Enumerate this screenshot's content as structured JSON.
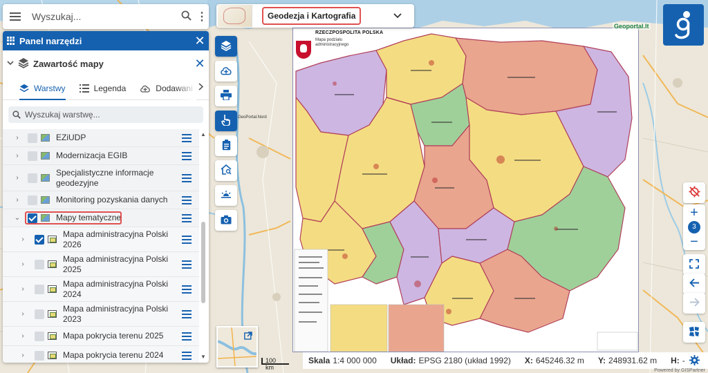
{
  "search": {
    "placeholder": "Wyszukaj...",
    "menu_icon": "hamburger-icon",
    "search_icon": "search-icon",
    "more_icon": "kebab-icon"
  },
  "theme": {
    "label": "Geodezja i Kartografia",
    "dropdown_icon": "chevron-down-icon"
  },
  "panel": {
    "title": "Panel narzędzi",
    "content_title": "Zawartość mapy",
    "tabs": [
      {
        "label": "Warstwy",
        "icon": "layers-icon",
        "active": true
      },
      {
        "label": "Legenda",
        "icon": "list-icon",
        "active": false
      },
      {
        "label": "Dodawani",
        "icon": "cloud-add-icon",
        "active": false
      }
    ],
    "layer_search_placeholder": "Wyszukaj warstwę...",
    "layers": [
      {
        "label": "EZiUDP",
        "checked": false,
        "level": 0
      },
      {
        "label": "Modernizacja EGIB",
        "checked": false,
        "level": 0
      },
      {
        "label": "Specjalistyczne informacje geodezyjne",
        "checked": false,
        "level": 0
      },
      {
        "label": "Monitoring pozyskania danych",
        "checked": false,
        "level": 0
      },
      {
        "label": "Mapy tematyczne",
        "checked": true,
        "level": 0,
        "expanded": true
      },
      {
        "label": "Mapa administracyjna Polski 2026",
        "checked": true,
        "level": 1
      },
      {
        "label": "Mapa administracyjna Polski 2025",
        "checked": false,
        "level": 1
      },
      {
        "label": "Mapa administracyjna Polski 2024",
        "checked": false,
        "level": 1
      },
      {
        "label": "Mapa administracyjna Polski 2023",
        "checked": false,
        "level": 1
      },
      {
        "label": "Mapa pokrycia terenu 2025",
        "checked": false,
        "level": 1
      },
      {
        "label": "Mapa pokrycia terenu 2024",
        "checked": false,
        "level": 1
      }
    ]
  },
  "map": {
    "poster_title": "RZECZPOSPOLITA POLSKA",
    "poster_subtitle": "Mapa podziału administracyjnego",
    "basemap_label": "GeoPortal.Nord",
    "watermark": "Geoportal.lt"
  },
  "status": {
    "scale_label": "Skala",
    "scale_value": "1:4 000 000",
    "crs_label": "Układ:",
    "crs_value": "EPSG 2180 (układ 1992)",
    "x_label": "X:",
    "x_value": "645246.32 m",
    "y_label": "Y:",
    "y_value": "248931.62 m",
    "h_label": "H:",
    "h_value": "-",
    "scalebar": "100 km",
    "powered": "Powered by GISPartner"
  },
  "zoom": {
    "in": "+",
    "out": "−",
    "level": "3"
  },
  "colors": {
    "accent": "#1561b0",
    "highlight": "#e05050"
  }
}
